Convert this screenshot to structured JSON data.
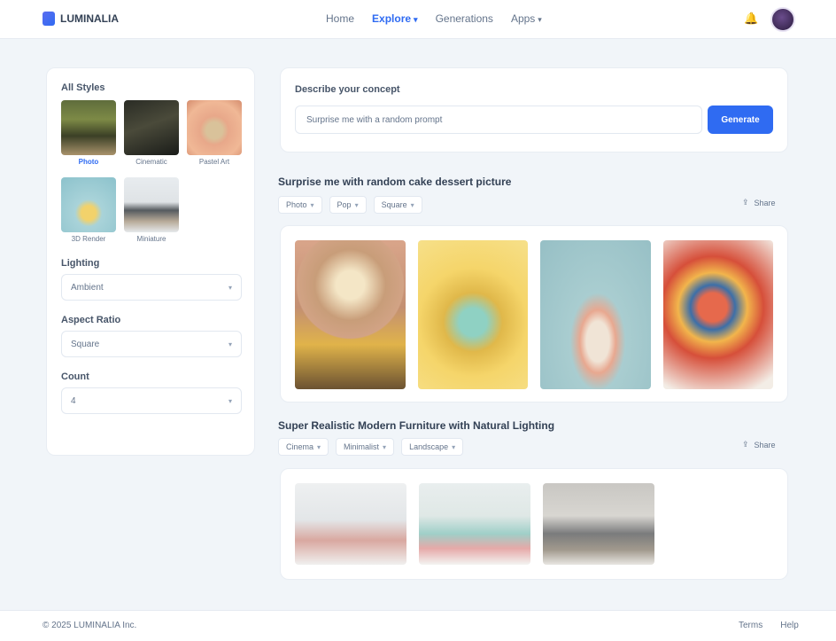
{
  "app": {
    "brand": "LUMINALIA"
  },
  "nav": {
    "items": [
      {
        "label": "Home",
        "dropdown": false
      },
      {
        "label": "Explore",
        "dropdown": true,
        "active": true
      },
      {
        "label": "Generations",
        "dropdown": false
      },
      {
        "label": "Apps",
        "dropdown": true
      }
    ]
  },
  "sidebar": {
    "styles_label": "All Styles",
    "styles": [
      {
        "name": "Photo",
        "selected": true
      },
      {
        "name": "Cinematic"
      },
      {
        "name": "Pastel Art"
      },
      {
        "name": "3D Render"
      },
      {
        "name": "Miniature"
      }
    ],
    "lighting": {
      "label": "Lighting",
      "value": "Ambient"
    },
    "aspect": {
      "label": "Aspect Ratio",
      "value": "Square"
    },
    "count": {
      "label": "Count",
      "value": "4"
    }
  },
  "search": {
    "title": "Describe your concept",
    "placeholder": "Surprise me with a random prompt",
    "button_label": "Generate"
  },
  "sections": [
    {
      "title": "Surprise me with random cake dessert picture",
      "chips": [
        "Photo",
        "Pop",
        "Square"
      ],
      "share_label": "Share",
      "images": [
        "cake-photo-1",
        "cake-photo-2",
        "cake-photo-3",
        "cake-photo-4"
      ]
    },
    {
      "title": "Super Realistic Modern Furniture with Natural Lighting",
      "chips": [
        "Cinema",
        "Minimalist",
        "Landscape"
      ],
      "share_label": "Share",
      "images": [
        "furniture-photo-1",
        "furniture-photo-2",
        "furniture-photo-3"
      ]
    }
  ],
  "footer": {
    "copyright": "© 2025 LUMINALIA Inc.",
    "links": [
      "Terms",
      "Help"
    ]
  }
}
